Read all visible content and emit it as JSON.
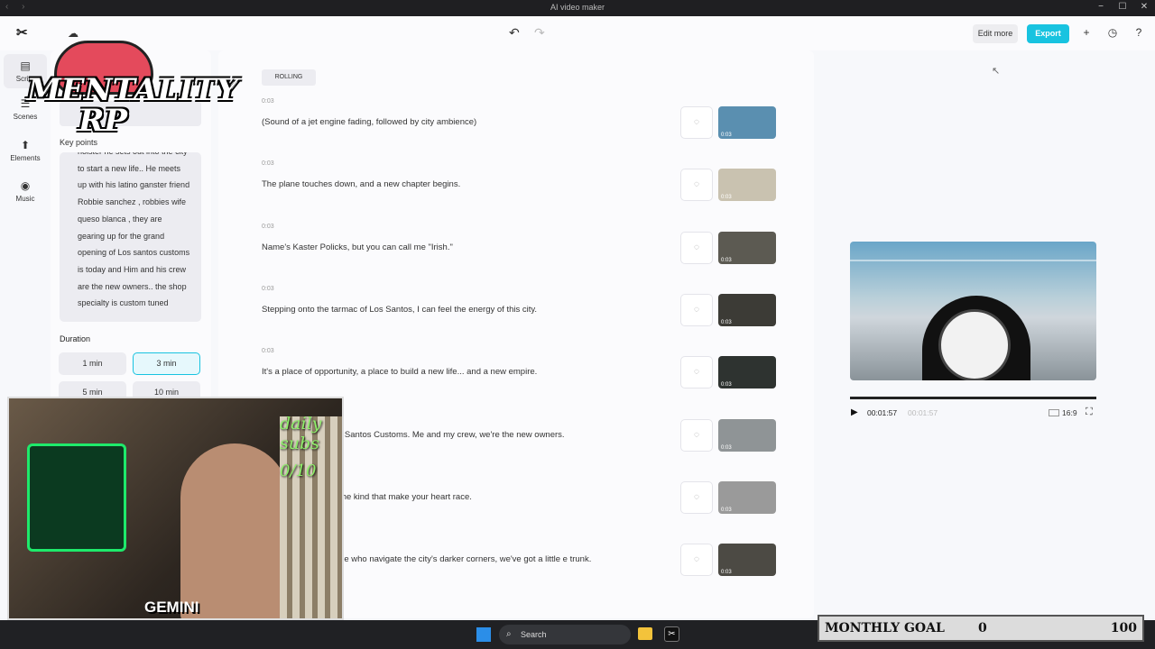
{
  "window": {
    "title": "AI video maker",
    "nav_arrows": "‹ ›",
    "controls": [
      "−",
      "☐",
      "✕"
    ]
  },
  "topbar": {
    "edit_more": "Edit more",
    "export": "Export",
    "icons": {
      "undo": "↶",
      "redo": "↷",
      "add": "+",
      "history": "◷",
      "help": "?"
    }
  },
  "sidenav": [
    {
      "label": "Script",
      "icon": "script-icon",
      "glyph": "▤"
    },
    {
      "label": "Scenes",
      "icon": "scenes-icon",
      "glyph": "☰"
    },
    {
      "label": "Elements",
      "icon": "elements-icon",
      "glyph": "⬆"
    },
    {
      "label": "Music",
      "icon": "music-icon",
      "glyph": "◉"
    }
  ],
  "left_panel": {
    "key_points_label": "Key points",
    "key_points_text": "hoister he sets out into the city to start a new life.. He meets up with his latino ganster friend Robbie sanchez , robbies wife queso blanca , they are gearing up for the grand opening of Los santos customs is today and Him and his crew are the new owners.. the shop specialty is custom tuned",
    "duration_label": "Duration",
    "durations": [
      "1 min",
      "3 min",
      "5 min",
      "10 min"
    ],
    "selected_duration": "3 min"
  },
  "script": {
    "style_tag": "ROLLING",
    "scenes": [
      {
        "time": "0:03",
        "text": "(Sound of a jet engine fading, followed by city ambience)",
        "thumb_dur": "0:03",
        "thumb_color": "#5a8fb0"
      },
      {
        "time": "0:03",
        "text": "The plane touches down, and a new chapter begins.",
        "thumb_dur": "0:03",
        "thumb_color": "#c9c2b0"
      },
      {
        "time": "0:03",
        "text": "Name's Kaster Policks, but you can call me \"Irish.\"",
        "thumb_dur": "0:03",
        "thumb_color": "#5c5a52"
      },
      {
        "time": "0:03",
        "text": "Stepping onto the tarmac of Los Santos, I can feel the energy of this city.",
        "thumb_dur": "0:03",
        "thumb_color": "#3c3b36"
      },
      {
        "time": "0:03",
        "text": "It's a place of opportunity, a place to build a new life... and a new empire.",
        "thumb_dur": "0:03",
        "thumb_color": "#2e3330"
      },
      {
        "time": "0:03",
        "text": "grand opening of Los Santos Customs. Me and my crew, we're the new owners.",
        "thumb_dur": "0:03",
        "thumb_color": "#8f9496"
      },
      {
        "time": "0:03",
        "text": "y tuned import cars, the kind that make your heart race.",
        "thumb_dur": "0:03",
        "thumb_color": "#9a9a9a"
      },
      {
        "time": "0:03",
        "text": "n just speed. For those who navigate the city's darker corners, we've got a little e trunk.",
        "thumb_dur": "0:03",
        "thumb_color": "#4c4a44"
      }
    ]
  },
  "player": {
    "current_time": "00:01:57",
    "total_time": "00:01:57",
    "aspect_ratio": "16:9"
  },
  "overlay": {
    "brand": "MENTALITY RP",
    "subs_label": "daily subs",
    "subs_count": "0/10",
    "streamer_tag": "GEMINI"
  },
  "taskbar": {
    "search_placeholder": "Search"
  },
  "monthly_goal": {
    "label": "MONTHLY GOAL",
    "current": "0",
    "target": "100"
  }
}
